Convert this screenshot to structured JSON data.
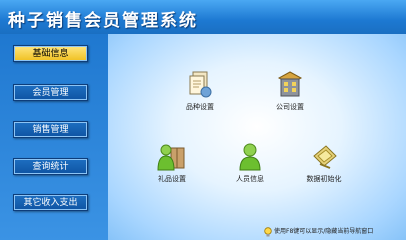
{
  "app": {
    "title": "种子销售会员管理系统"
  },
  "sidebar": {
    "items": [
      {
        "label": "基础信息",
        "active": true
      },
      {
        "label": "会员管理",
        "active": false
      },
      {
        "label": "销售管理",
        "active": false
      },
      {
        "label": "查询统计",
        "active": false
      },
      {
        "label": "其它收入支出",
        "active": false
      }
    ]
  },
  "main": {
    "features": [
      {
        "label": "品种设置",
        "icon": "documents-icon"
      },
      {
        "label": "公司设置",
        "icon": "building-icon"
      },
      {
        "label": "礼品设置",
        "icon": "user-gift-icon"
      },
      {
        "label": "人员信息",
        "icon": "user-icon"
      },
      {
        "label": "数据初始化",
        "icon": "data-init-icon"
      }
    ]
  },
  "footer": {
    "hint": "使用F8键可以显示/隐藏当前导航窗口",
    "icon": "lightbulb-icon"
  }
}
